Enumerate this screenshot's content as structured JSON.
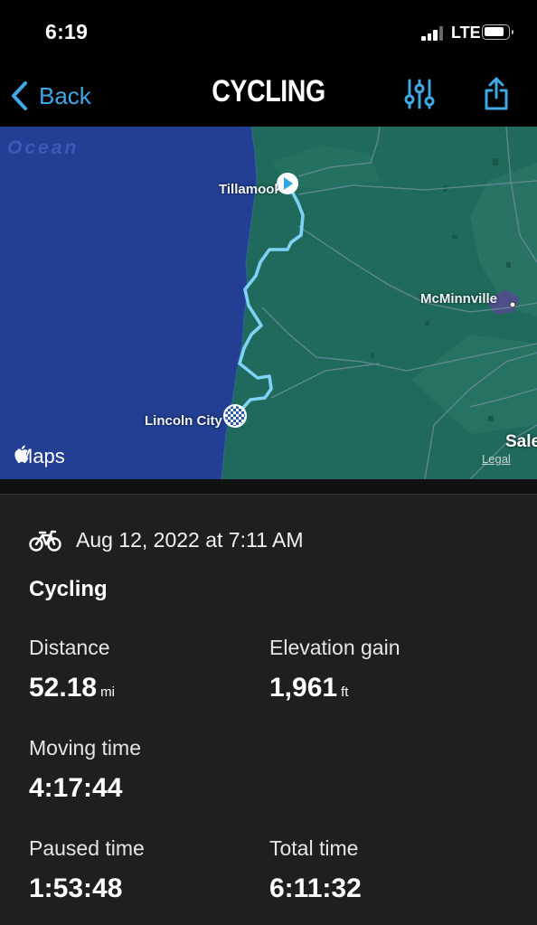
{
  "status": {
    "time": "6:19",
    "network": "LTE"
  },
  "nav": {
    "back_label": "Back",
    "title": "CYCLING"
  },
  "map": {
    "ocean_label": "Ocean",
    "places": {
      "start": "Tillamook",
      "mcminnville": "McMinnville",
      "finish": "Lincoln City",
      "salem": "Sale"
    },
    "brand": "Maps",
    "legal": "Legal",
    "colors": {
      "ocean": "#233f93",
      "land": "#1f6a5c",
      "route": "#7fd2f5"
    }
  },
  "workout": {
    "date": "Aug 12, 2022 at 7:11 AM",
    "activity": "Cycling",
    "distance": {
      "label": "Distance",
      "value": "52.18",
      "unit": "mi"
    },
    "elevation": {
      "label": "Elevation gain",
      "value": "1,961",
      "unit": "ft"
    },
    "moving_time": {
      "label": "Moving time",
      "value": "4:17:44"
    },
    "paused_time": {
      "label": "Paused time",
      "value": "1:53:48"
    },
    "total_time": {
      "label": "Total time",
      "value": "6:11:32"
    }
  },
  "accent_color": "#3fa9e6"
}
